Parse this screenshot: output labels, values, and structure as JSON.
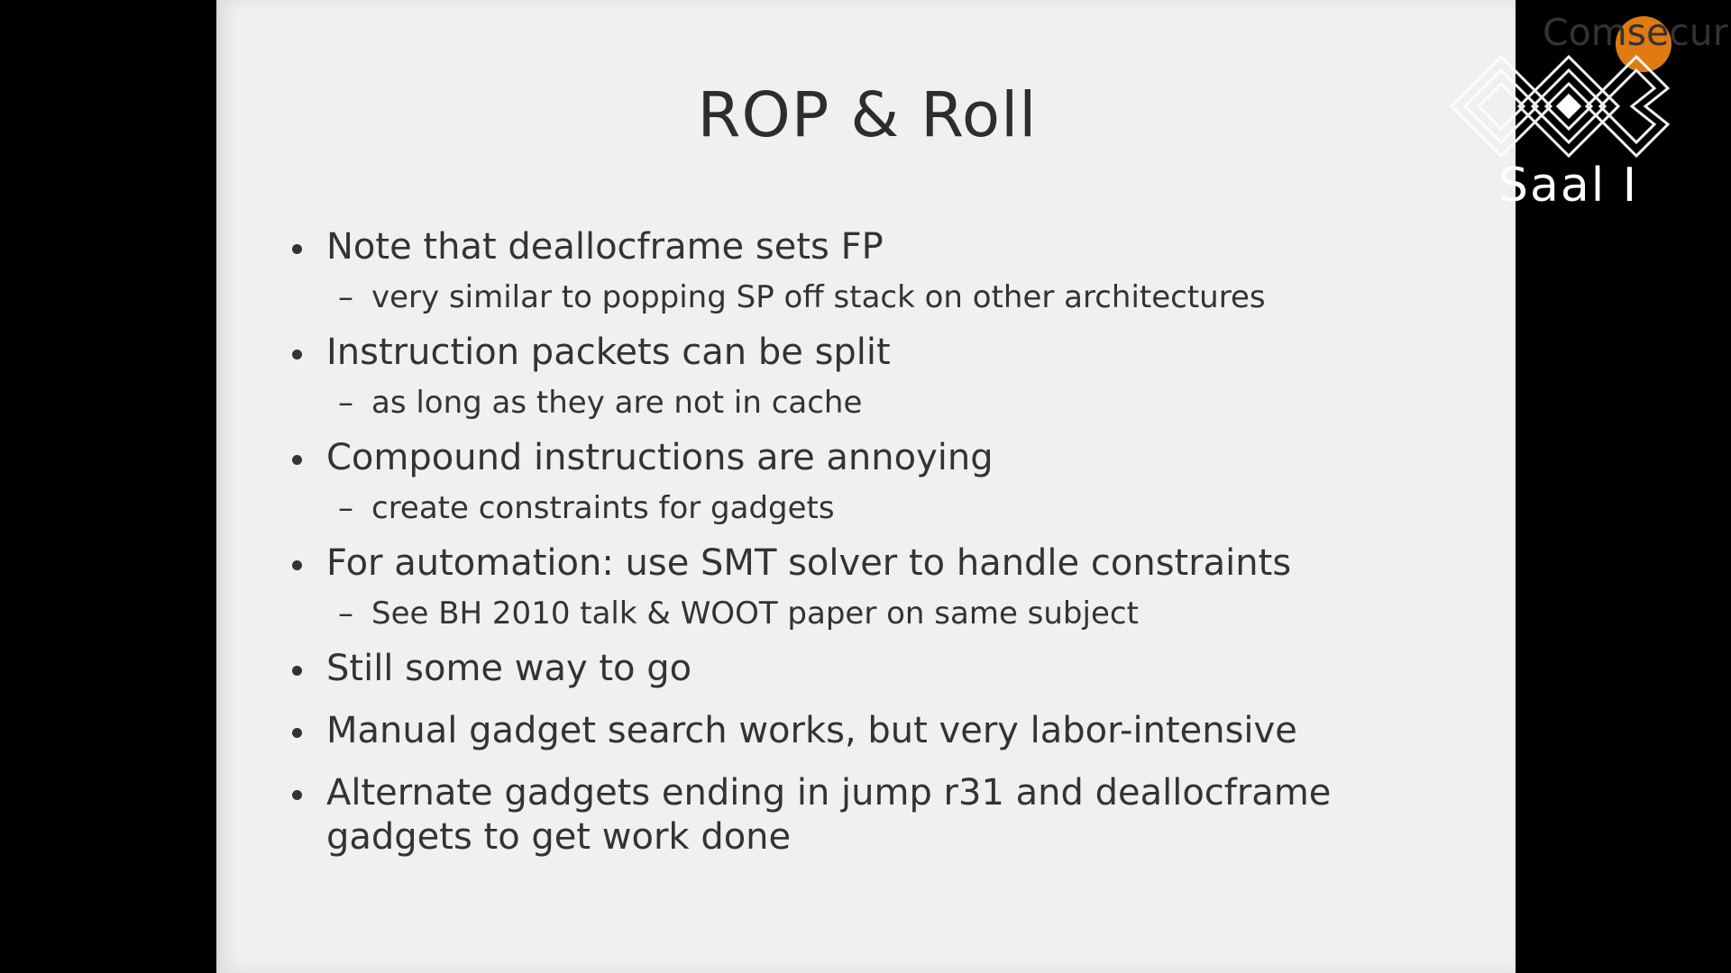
{
  "slide": {
    "title": "ROP & Roll",
    "brand": "Comsecuris",
    "bullets": [
      {
        "text": "Note that deallocframe sets FP",
        "sub": [
          "very similar to popping SP off stack on other architectures"
        ]
      },
      {
        "text": "Instruction packets can be split",
        "sub": [
          "as long as they are not in cache"
        ]
      },
      {
        "text": "Compound instructions are annoying",
        "sub": [
          "create constraints for gadgets"
        ]
      },
      {
        "text": "For automation: use SMT solver to handle constraints",
        "sub": [
          "See BH 2010 talk & WOOT paper on same subject"
        ]
      },
      {
        "text": "Still some way to go",
        "sub": []
      },
      {
        "text": "Manual gadget search works, but very labor-intensive",
        "sub": []
      },
      {
        "text": "Alternate gadgets ending in jump r31 and deallocframe gadgets to get work done",
        "sub": []
      }
    ]
  },
  "overlay": {
    "room": "Saal I",
    "logo_icon": "congress-logo-icon"
  },
  "colors": {
    "background": "#000000",
    "slide": "#f1eff0",
    "text": "#333333",
    "brand_accent": "#e07a12"
  }
}
